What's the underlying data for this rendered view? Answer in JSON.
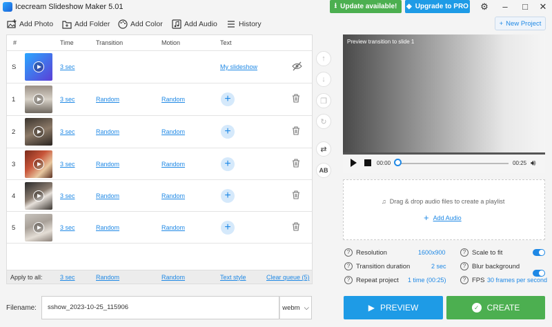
{
  "window": {
    "title": "Icecream Slideshow Maker 5.01",
    "update_label": "Update available!",
    "pro_label": "Upgrade to PRO"
  },
  "toolbar": {
    "add_photo": "Add Photo",
    "add_folder": "Add Folder",
    "add_color": "Add Color",
    "add_audio": "Add Audio",
    "history": "History",
    "new_project": "New Project"
  },
  "table": {
    "headers": {
      "num": "#",
      "time": "Time",
      "transition": "Transition",
      "motion": "Motion",
      "text": "Text"
    },
    "rows": [
      {
        "num": "S",
        "time": "3 sec",
        "transition": "",
        "motion": "",
        "text": "My slideshow",
        "thumb": "title"
      },
      {
        "num": "1",
        "time": "3 sec",
        "transition": "Random",
        "motion": "Random",
        "thumb": "photo1"
      },
      {
        "num": "2",
        "time": "3 sec",
        "transition": "Random",
        "motion": "Random",
        "thumb": "photo2"
      },
      {
        "num": "3",
        "time": "3 sec",
        "transition": "Random",
        "motion": "Random",
        "thumb": "photo3"
      },
      {
        "num": "4",
        "time": "3 sec",
        "transition": "Random",
        "motion": "Random",
        "thumb": "photo4"
      },
      {
        "num": "5",
        "time": "3 sec",
        "transition": "Random",
        "motion": "Random",
        "thumb": "photo5"
      }
    ],
    "apply_all": {
      "label": "Apply to all:",
      "time": "3 sec",
      "transition": "Random",
      "motion": "Random",
      "text": "Text style",
      "clear": "Clear queue (5)"
    }
  },
  "filename": {
    "label": "Filename:",
    "value": "sshow_2023-10-25_115906",
    "format": "webm"
  },
  "preview": {
    "caption": "Preview transition to slide 1",
    "time_current": "00:00",
    "time_total": "00:25"
  },
  "audio": {
    "drop_text": "Drag & drop audio files to create a playlist",
    "add_label": "Add Audio"
  },
  "settings": {
    "resolution_label": "Resolution",
    "resolution_value": "1600x900",
    "transition_label": "Transition duration",
    "transition_value": "2 sec",
    "repeat_label": "Repeat project",
    "repeat_value": "1 time (00:25)",
    "scale_label": "Scale to fit",
    "blur_label": "Blur background",
    "fps_label": "FPS",
    "fps_value": "30 frames per second"
  },
  "actions": {
    "preview_label": "PREVIEW",
    "create_label": "CREATE"
  },
  "colors": {
    "accent": "#1e88e5",
    "green": "#4caf50",
    "blue_btn": "#1e9be6"
  }
}
